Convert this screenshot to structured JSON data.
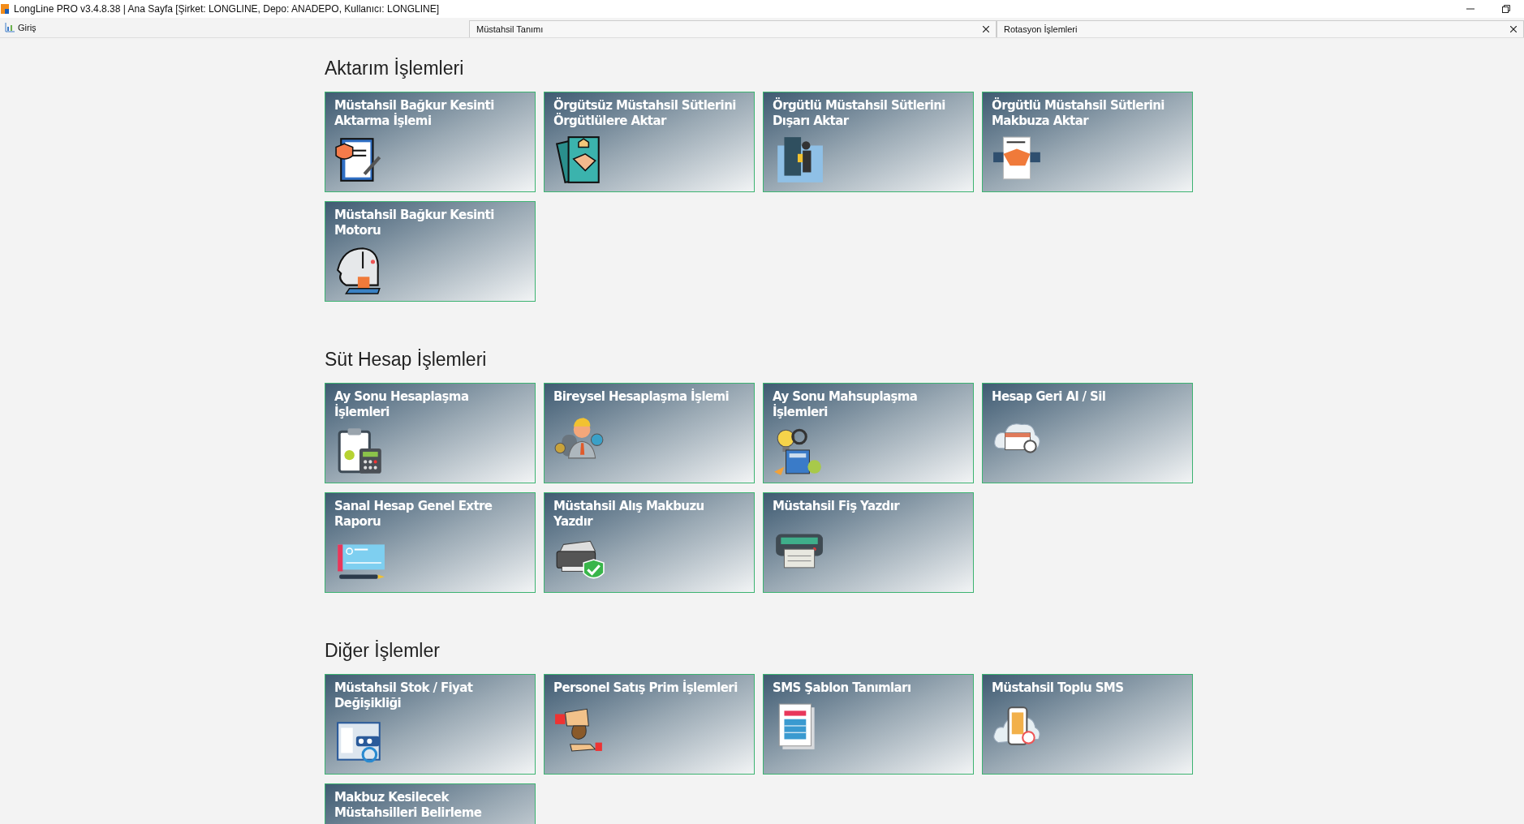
{
  "window": {
    "title": "LongLine PRO v3.4.8.38 | Ana Sayfa [Şirket: LONGLINE, Depo: ANADEPO, Kullanıcı: LONGLINE]"
  },
  "home_tab": {
    "label": "Giriş"
  },
  "tabs": [
    {
      "label": "Müstahsil Tanımı"
    },
    {
      "label": "Rotasyon İşlemleri"
    }
  ],
  "sections": [
    {
      "title": "Aktarım İşlemleri",
      "tiles": [
        {
          "title": "Müstahsil Bağkur Kesinti Aktarma İşlemi"
        },
        {
          "title": "Örgütsüz Müstahsil Sütlerini Örgütlülere Aktar"
        },
        {
          "title": "Örgütlü Müstahsil Sütlerini Dışarı Aktar"
        },
        {
          "title": "Örgütlü Müstahsil Sütlerini Makbuza Aktar"
        },
        {
          "title": "Müstahsil Bağkur Kesinti Motoru"
        }
      ]
    },
    {
      "title": "Süt Hesap İşlemleri",
      "tiles": [
        {
          "title": "Ay Sonu Hesaplaşma İşlemleri"
        },
        {
          "title": "Bireysel Hesaplaşma İşlemi"
        },
        {
          "title": "Ay Sonu Mahsuplaşma İşlemleri"
        },
        {
          "title": "Hesap Geri Al / Sil"
        },
        {
          "title": "Sanal Hesap Genel Extre Raporu"
        },
        {
          "title": "Müstahsil Alış Makbuzu Yazdır"
        },
        {
          "title": "Müstahsil Fiş Yazdır"
        }
      ]
    },
    {
      "title": "Diğer İşlemler",
      "tiles": [
        {
          "title": "Müstahsil Stok / Fiyat Değişikliği"
        },
        {
          "title": "Personel Satış Prim İşlemleri"
        },
        {
          "title": "SMS Şablon Tanımları"
        },
        {
          "title": "Müstahsil Toplu SMS"
        },
        {
          "title": "Makbuz Kesilecek Müstahsilleri Belirleme"
        }
      ]
    }
  ]
}
